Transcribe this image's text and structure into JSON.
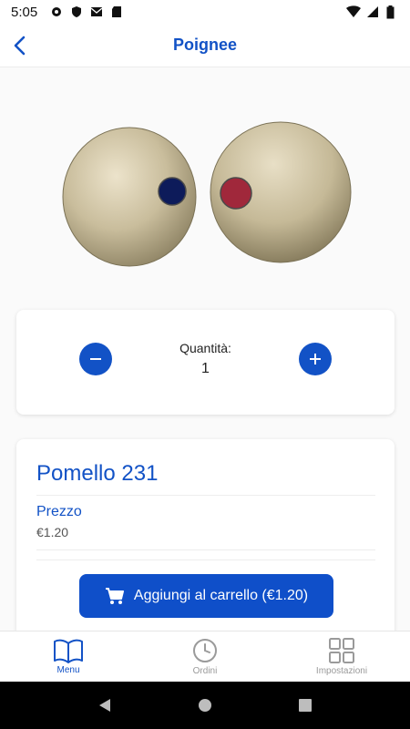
{
  "status_bar": {
    "time": "5:05",
    "left_icons": [
      "settings-icon",
      "shield-icon",
      "mail-icon",
      "sd-card-icon"
    ],
    "right_icons": [
      "wifi-icon",
      "signal-icon",
      "battery-icon"
    ]
  },
  "app_bar": {
    "title": "Poignee",
    "back_icon": "chevron-left-icon"
  },
  "product": {
    "image_description_icon": "door-knob-pair-image",
    "quantity_label": "Quantità:",
    "quantity_value": "1",
    "name": "Pomello 231",
    "price_label": "Prezzo",
    "price_value": "€1.20",
    "add_to_cart_label": "Aggiungi al carrello (€1.20)"
  },
  "bottom_nav": {
    "items": [
      {
        "label": "Menu",
        "icon": "book-icon",
        "active": true
      },
      {
        "label": "Ordini",
        "icon": "clock-icon",
        "active": false
      },
      {
        "label": "Impostazioni",
        "icon": "grid-icon",
        "active": false
      }
    ]
  },
  "colors": {
    "accent": "#1252c6",
    "button": "#0f4fc9",
    "inactive": "#9a9a9a"
  }
}
